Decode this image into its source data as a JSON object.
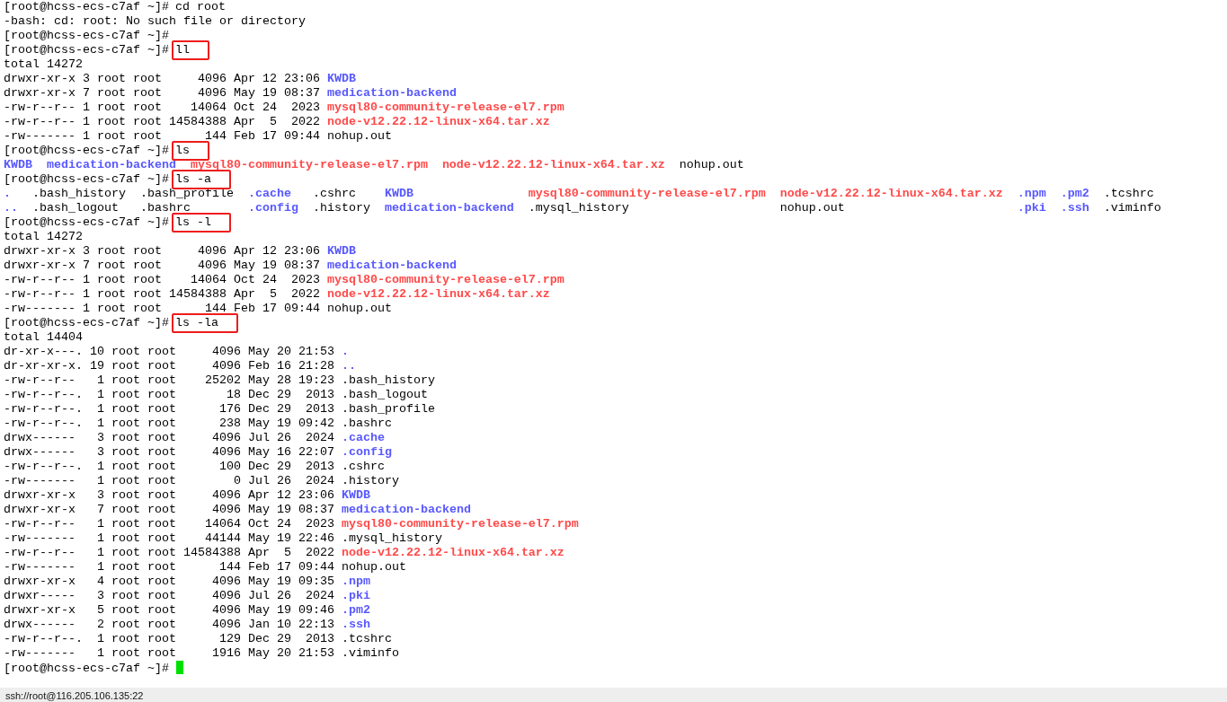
{
  "terminal": {
    "lines": [
      {
        "kind": "prompt",
        "prompt": "[root@hcss-ecs-c7af ~]#",
        "command": "cd root",
        "highlighted": false
      },
      {
        "kind": "output",
        "segments": [
          {
            "kind": "plain",
            "text": "-bash: cd: root: No such file or directory"
          }
        ]
      },
      {
        "kind": "prompt",
        "prompt": "[root@hcss-ecs-c7af ~]#"
      },
      {
        "kind": "prompt",
        "prompt": "[root@hcss-ecs-c7af ~]#",
        "command": "ll",
        "highlighted": true
      },
      {
        "kind": "output",
        "segments": [
          {
            "kind": "plain",
            "text": "total 14272"
          }
        ]
      },
      {
        "kind": "output",
        "segments": [
          {
            "kind": "plain",
            "text": "drwxr-xr-x 3 root root     4096 Apr 12 23:06 "
          },
          {
            "kind": "dir",
            "text": "KWDB"
          }
        ]
      },
      {
        "kind": "output",
        "segments": [
          {
            "kind": "plain",
            "text": "drwxr-xr-x 7 root root     4096 May 19 08:37 "
          },
          {
            "kind": "dir",
            "text": "medication-backend"
          }
        ]
      },
      {
        "kind": "output",
        "segments": [
          {
            "kind": "plain",
            "text": "-rw-r--r-- 1 root root    14064 Oct 24  2023 "
          },
          {
            "kind": "archive",
            "text": "mysql80-community-release-el7.rpm"
          }
        ]
      },
      {
        "kind": "output",
        "segments": [
          {
            "kind": "plain",
            "text": "-rw-r--r-- 1 root root 14584388 Apr  5  2022 "
          },
          {
            "kind": "archive",
            "text": "node-v12.22.12-linux-x64.tar.xz"
          }
        ]
      },
      {
        "kind": "output",
        "segments": [
          {
            "kind": "plain",
            "text": "-rw------- 1 root root      144 Feb 17 09:44 nohup.out"
          }
        ]
      },
      {
        "kind": "prompt",
        "prompt": "[root@hcss-ecs-c7af ~]#",
        "command": "ls",
        "highlighted": true
      },
      {
        "kind": "listing",
        "columns": [
          [
            {
              "kind": "dir",
              "text": "KWDB"
            }
          ],
          [
            {
              "kind": "dir",
              "text": "medication-backend"
            }
          ],
          [
            {
              "kind": "archive",
              "text": "mysql80-community-release-el7.rpm"
            }
          ],
          [
            {
              "kind": "archive",
              "text": "node-v12.22.12-linux-x64.tar.xz"
            }
          ],
          [
            {
              "kind": "plain",
              "text": "nohup.out"
            }
          ]
        ]
      },
      {
        "kind": "prompt",
        "prompt": "[root@hcss-ecs-c7af ~]#",
        "command": "ls -a",
        "highlighted": true
      },
      {
        "kind": "listing",
        "columns": [
          [
            {
              "kind": "dir",
              "text": "."
            },
            {
              "kind": "dir",
              "text": ".."
            }
          ],
          [
            {
              "kind": "plain",
              "text": ".bash_history"
            },
            {
              "kind": "plain",
              "text": ".bash_logout"
            }
          ],
          [
            {
              "kind": "plain",
              "text": ".bash_profile"
            },
            {
              "kind": "plain",
              "text": ".bashrc"
            }
          ],
          [
            {
              "kind": "dir",
              "text": ".cache"
            },
            {
              "kind": "dir",
              "text": ".config"
            }
          ],
          [
            {
              "kind": "plain",
              "text": ".cshrc"
            },
            {
              "kind": "plain",
              "text": ".history"
            }
          ],
          [
            {
              "kind": "dir",
              "text": "KWDB"
            },
            {
              "kind": "dir",
              "text": "medication-backend"
            }
          ],
          [
            {
              "kind": "archive",
              "text": "mysql80-community-release-el7.rpm"
            },
            {
              "kind": "plain",
              "text": ".mysql_history"
            }
          ],
          [
            {
              "kind": "archive",
              "text": "node-v12.22.12-linux-x64.tar.xz"
            },
            {
              "kind": "plain",
              "text": "nohup.out"
            }
          ],
          [
            {
              "kind": "dir",
              "text": ".npm"
            },
            {
              "kind": "dir",
              "text": ".pki"
            }
          ],
          [
            {
              "kind": "dir",
              "text": ".pm2"
            },
            {
              "kind": "dir",
              "text": ".ssh"
            }
          ],
          [
            {
              "kind": "plain",
              "text": ".tcshrc"
            },
            {
              "kind": "plain",
              "text": ".viminfo"
            }
          ]
        ]
      },
      {
        "kind": "prompt",
        "prompt": "[root@hcss-ecs-c7af ~]#",
        "command": "ls -l",
        "highlighted": true
      },
      {
        "kind": "output",
        "segments": [
          {
            "kind": "plain",
            "text": "total 14272"
          }
        ]
      },
      {
        "kind": "output",
        "segments": [
          {
            "kind": "plain",
            "text": "drwxr-xr-x 3 root root     4096 Apr 12 23:06 "
          },
          {
            "kind": "dir",
            "text": "KWDB"
          }
        ]
      },
      {
        "kind": "output",
        "segments": [
          {
            "kind": "plain",
            "text": "drwxr-xr-x 7 root root     4096 May 19 08:37 "
          },
          {
            "kind": "dir",
            "text": "medication-backend"
          }
        ]
      },
      {
        "kind": "output",
        "segments": [
          {
            "kind": "plain",
            "text": "-rw-r--r-- 1 root root    14064 Oct 24  2023 "
          },
          {
            "kind": "archive",
            "text": "mysql80-community-release-el7.rpm"
          }
        ]
      },
      {
        "kind": "output",
        "segments": [
          {
            "kind": "plain",
            "text": "-rw-r--r-- 1 root root 14584388 Apr  5  2022 "
          },
          {
            "kind": "archive",
            "text": "node-v12.22.12-linux-x64.tar.xz"
          }
        ]
      },
      {
        "kind": "output",
        "segments": [
          {
            "kind": "plain",
            "text": "-rw------- 1 root root      144 Feb 17 09:44 nohup.out"
          }
        ]
      },
      {
        "kind": "prompt",
        "prompt": "[root@hcss-ecs-c7af ~]#",
        "command": "ls -la",
        "highlighted": true
      },
      {
        "kind": "output",
        "segments": [
          {
            "kind": "plain",
            "text": "total 14404"
          }
        ]
      },
      {
        "kind": "output",
        "segments": [
          {
            "kind": "plain",
            "text": "dr-xr-x---. 10 root root     4096 May 20 21:53 "
          },
          {
            "kind": "dir",
            "text": "."
          }
        ]
      },
      {
        "kind": "output",
        "segments": [
          {
            "kind": "plain",
            "text": "dr-xr-xr-x. 19 root root     4096 Feb 16 21:28 "
          },
          {
            "kind": "dir",
            "text": ".."
          }
        ]
      },
      {
        "kind": "output",
        "segments": [
          {
            "kind": "plain",
            "text": "-rw-r--r--   1 root root    25202 May 28 19:23 .bash_history"
          }
        ]
      },
      {
        "kind": "output",
        "segments": [
          {
            "kind": "plain",
            "text": "-rw-r--r--.  1 root root       18 Dec 29  2013 .bash_logout"
          }
        ]
      },
      {
        "kind": "output",
        "segments": [
          {
            "kind": "plain",
            "text": "-rw-r--r--.  1 root root      176 Dec 29  2013 .bash_profile"
          }
        ]
      },
      {
        "kind": "output",
        "segments": [
          {
            "kind": "plain",
            "text": "-rw-r--r--.  1 root root      238 May 19 09:42 .bashrc"
          }
        ]
      },
      {
        "kind": "output",
        "segments": [
          {
            "kind": "plain",
            "text": "drwx------   3 root root     4096 Jul 26  2024 "
          },
          {
            "kind": "dir",
            "text": ".cache"
          }
        ]
      },
      {
        "kind": "output",
        "segments": [
          {
            "kind": "plain",
            "text": "drwx------   3 root root     4096 May 16 22:07 "
          },
          {
            "kind": "dir",
            "text": ".config"
          }
        ]
      },
      {
        "kind": "output",
        "segments": [
          {
            "kind": "plain",
            "text": "-rw-r--r--.  1 root root      100 Dec 29  2013 .cshrc"
          }
        ]
      },
      {
        "kind": "output",
        "segments": [
          {
            "kind": "plain",
            "text": "-rw-------   1 root root        0 Jul 26  2024 .history"
          }
        ]
      },
      {
        "kind": "output",
        "segments": [
          {
            "kind": "plain",
            "text": "drwxr-xr-x   3 root root     4096 Apr 12 23:06 "
          },
          {
            "kind": "dir",
            "text": "KWDB"
          }
        ]
      },
      {
        "kind": "output",
        "segments": [
          {
            "kind": "plain",
            "text": "drwxr-xr-x   7 root root     4096 May 19 08:37 "
          },
          {
            "kind": "dir",
            "text": "medication-backend"
          }
        ]
      },
      {
        "kind": "output",
        "segments": [
          {
            "kind": "plain",
            "text": "-rw-r--r--   1 root root    14064 Oct 24  2023 "
          },
          {
            "kind": "archive",
            "text": "mysql80-community-release-el7.rpm"
          }
        ]
      },
      {
        "kind": "output",
        "segments": [
          {
            "kind": "plain",
            "text": "-rw-------   1 root root    44144 May 19 22:46 .mysql_history"
          }
        ]
      },
      {
        "kind": "output",
        "segments": [
          {
            "kind": "plain",
            "text": "-rw-r--r--   1 root root 14584388 Apr  5  2022 "
          },
          {
            "kind": "archive",
            "text": "node-v12.22.12-linux-x64.tar.xz"
          }
        ]
      },
      {
        "kind": "output",
        "segments": [
          {
            "kind": "plain",
            "text": "-rw-------   1 root root      144 Feb 17 09:44 nohup.out"
          }
        ]
      },
      {
        "kind": "output",
        "segments": [
          {
            "kind": "plain",
            "text": "drwxr-xr-x   4 root root     4096 May 19 09:35 "
          },
          {
            "kind": "dir",
            "text": ".npm"
          }
        ]
      },
      {
        "kind": "output",
        "segments": [
          {
            "kind": "plain",
            "text": "drwxr-----   3 root root     4096 Jul 26  2024 "
          },
          {
            "kind": "dir",
            "text": ".pki"
          }
        ]
      },
      {
        "kind": "output",
        "segments": [
          {
            "kind": "plain",
            "text": "drwxr-xr-x   5 root root     4096 May 19 09:46 "
          },
          {
            "kind": "dir",
            "text": ".pm2"
          }
        ]
      },
      {
        "kind": "output",
        "segments": [
          {
            "kind": "plain",
            "text": "drwx------   2 root root     4096 Jan 10 22:13 "
          },
          {
            "kind": "dir",
            "text": ".ssh"
          }
        ]
      },
      {
        "kind": "output",
        "segments": [
          {
            "kind": "plain",
            "text": "-rw-r--r--.  1 root root      129 Dec 29  2013 .tcshrc"
          }
        ]
      },
      {
        "kind": "output",
        "segments": [
          {
            "kind": "plain",
            "text": "-rw-------   1 root root     1916 May 20 21:53 .viminfo"
          }
        ]
      },
      {
        "kind": "prompt",
        "prompt": "[root@hcss-ecs-c7af ~]#",
        "cursor": true
      }
    ]
  },
  "status_bar": {
    "text": "ssh://root@116.205.106.135:22"
  }
}
